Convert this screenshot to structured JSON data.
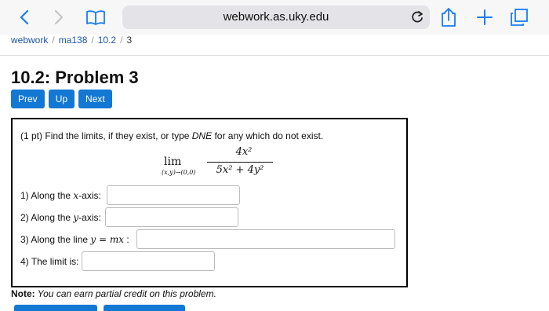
{
  "browser": {
    "url": "webwork.as.uky.edu",
    "icons": [
      "back-icon",
      "forward-icon",
      "bookmarks-icon",
      "reload-icon",
      "share-icon",
      "new-tab-icon",
      "tabs-icon"
    ]
  },
  "breadcrumb": [
    "webwork",
    "ma138",
    "10.2",
    "3"
  ],
  "page_title": "10.2: Problem 3",
  "nav_buttons": {
    "prev": "Prev",
    "up": "Up",
    "next": "Next"
  },
  "problem": {
    "points": "(1 pt)",
    "prompt_a": "Find the limits, if they exist, or type ",
    "prompt_dne": "DNE",
    "prompt_b": " for any which do not exist.",
    "formula": {
      "lim": "lim",
      "sub": "(x,y)→(0,0)",
      "numerator": "4x²",
      "denominator": "5x² + 4y²"
    },
    "questions": [
      {
        "prefix": "1) Along the ",
        "var": "x",
        "suffix": "-axis:",
        "value": ""
      },
      {
        "prefix": "2) Along the ",
        "var": "y",
        "suffix": "-axis:",
        "value": ""
      },
      {
        "prefix": "3) Along the line ",
        "var": "y = mx",
        "suffix": " :",
        "value": ""
      },
      {
        "prefix": "4) The limit is:",
        "var": "",
        "suffix": "",
        "value": ""
      }
    ]
  },
  "note": {
    "label": "Note:",
    "text": " You can earn partial credit on this problem."
  }
}
